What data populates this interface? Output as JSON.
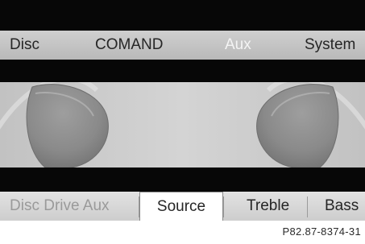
{
  "main_menu": {
    "items": [
      {
        "label": "Disc",
        "active": false
      },
      {
        "label": "COMAND",
        "active": false
      },
      {
        "label": "Aux",
        "active": true
      },
      {
        "label": "System",
        "active": false
      }
    ]
  },
  "display": {
    "graphic_icon": "headphones-icon"
  },
  "sub_menu": {
    "disc_drive_aux": "Disc Drive Aux",
    "source": "Source",
    "treble": "Treble",
    "bass": "Bass"
  },
  "footer": {
    "reference": "P82.87-8374-31"
  },
  "colors": {
    "active_menu_text": "#f4f4f4",
    "inactive_menu_text": "#262626",
    "disabled_text": "#9a9a9a",
    "band": "#070707"
  }
}
